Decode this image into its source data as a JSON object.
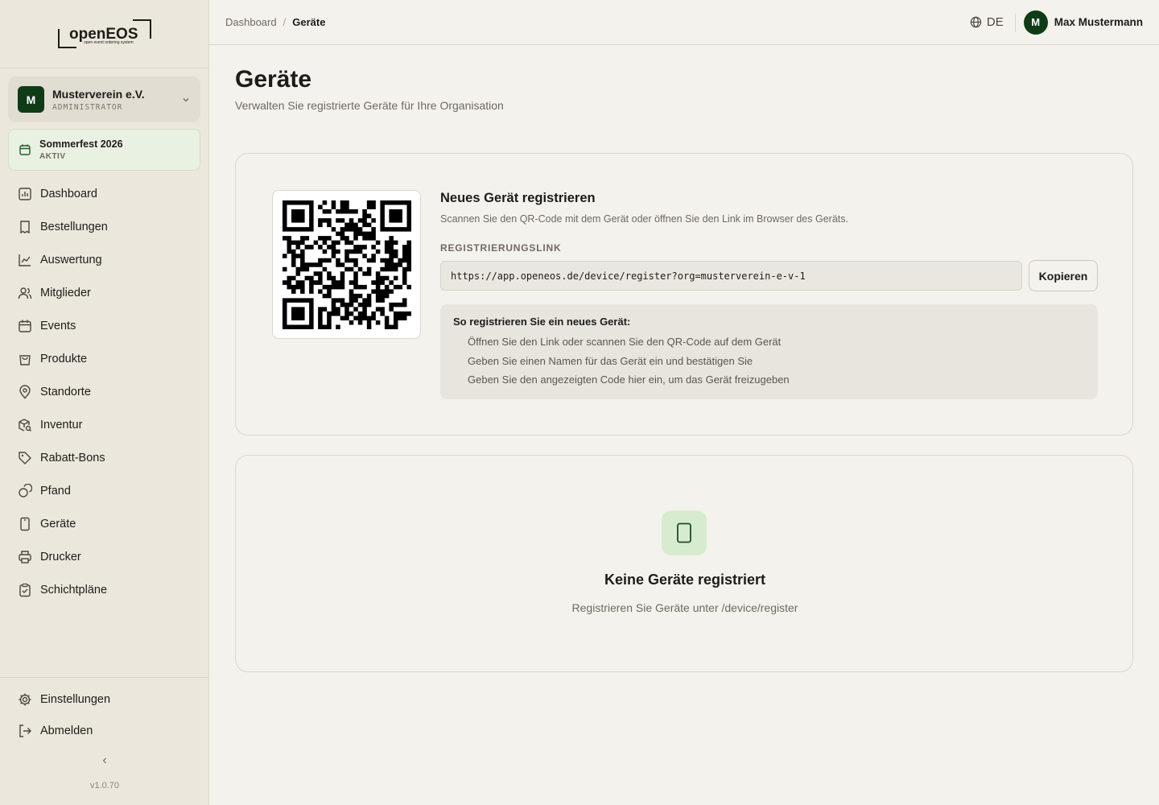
{
  "brand": {
    "logo_text": "openEOS",
    "logo_tagline": "open event ordering system"
  },
  "org": {
    "initial": "M",
    "name": "Musterverein e.V.",
    "role": "ADMINISTRATOR"
  },
  "event": {
    "name": "Sommerfest 2026",
    "status": "AKTIV"
  },
  "sidebar": {
    "items": [
      {
        "label": "Dashboard",
        "icon": "chart-icon"
      },
      {
        "label": "Bestellungen",
        "icon": "receipt-icon"
      },
      {
        "label": "Auswertung",
        "icon": "trend-icon"
      },
      {
        "label": "Mitglieder",
        "icon": "users-icon"
      },
      {
        "label": "Events",
        "icon": "calendar-icon"
      },
      {
        "label": "Produkte",
        "icon": "bag-icon"
      },
      {
        "label": "Standorte",
        "icon": "pin-icon"
      },
      {
        "label": "Inventur",
        "icon": "box-search-icon"
      },
      {
        "label": "Rabatt-Bons",
        "icon": "tag-icon"
      },
      {
        "label": "Pfand",
        "icon": "coins-icon"
      },
      {
        "label": "Geräte",
        "icon": "device-icon"
      },
      {
        "label": "Drucker",
        "icon": "printer-icon"
      },
      {
        "label": "Schichtpläne",
        "icon": "clipboard-icon"
      }
    ],
    "bottom": [
      {
        "label": "Einstellungen",
        "icon": "gear-icon"
      },
      {
        "label": "Abmelden",
        "icon": "logout-icon"
      }
    ],
    "collapse_glyph": "‹",
    "version": "v1.0.70"
  },
  "header": {
    "breadcrumb_root": "Dashboard",
    "breadcrumb_sep": "/",
    "breadcrumb_current": "Geräte",
    "language": "DE",
    "user_initial": "M",
    "user_name": "Max Mustermann"
  },
  "page": {
    "title": "Geräte",
    "subtitle": "Verwalten Sie registrierte Geräte für Ihre Organisation"
  },
  "register": {
    "title": "Neues Gerät registrieren",
    "description": "Scannen Sie den QR-Code mit dem Gerät oder öffnen Sie den Link im Browser des Geräts.",
    "link_label": "REGISTRIERUNGSLINK",
    "link_value": "https://app.openeos.de/device/register?org=musterverein-e-v-1",
    "copy_label": "Kopieren",
    "instructions_title": "So registrieren Sie ein neues Gerät:",
    "steps": [
      "Öffnen Sie den Link oder scannen Sie den QR-Code auf dem Gerät",
      "Geben Sie einen Namen für das Gerät ein und bestätigen Sie",
      "Geben Sie den angezeigten Code hier ein, um das Gerät freizugeben"
    ]
  },
  "empty": {
    "title": "Keine Geräte registriert",
    "subtitle": "Registrieren Sie Geräte unter /device/register"
  },
  "colors": {
    "accent": "#0f3b17",
    "background": "#f4f2ec",
    "sidebar": "#ece7dc",
    "empty_icon_bg": "#d7eccf"
  }
}
